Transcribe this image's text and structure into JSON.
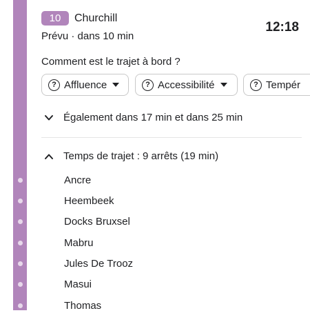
{
  "header": {
    "route_number": "10",
    "destination": "Churchill",
    "status": "Prévu · dans 10 min",
    "time": "12:18"
  },
  "feedback": {
    "question": "Comment est le trajet à bord ?",
    "chips": [
      {
        "label": "Affluence",
        "icon": "help-circle-icon"
      },
      {
        "label": "Accessibilité",
        "icon": "help-circle-icon"
      },
      {
        "label": "Tempér",
        "icon": "help-circle-icon"
      }
    ]
  },
  "also": {
    "label": "Également dans 17 min et dans 25 min",
    "icon": "chevron-down-icon"
  },
  "trip": {
    "label": "Temps de trajet : 9 arrêts (19 min)",
    "icon": "chevron-up-icon",
    "stops": [
      "Ancre",
      "Heembeek",
      "Docks Bruxsel",
      "Mabru",
      "Jules De Trooz",
      "Masui",
      "Thomas"
    ]
  },
  "colors": {
    "route": "#b185bb",
    "rail_dot": "#e7d8ea"
  }
}
